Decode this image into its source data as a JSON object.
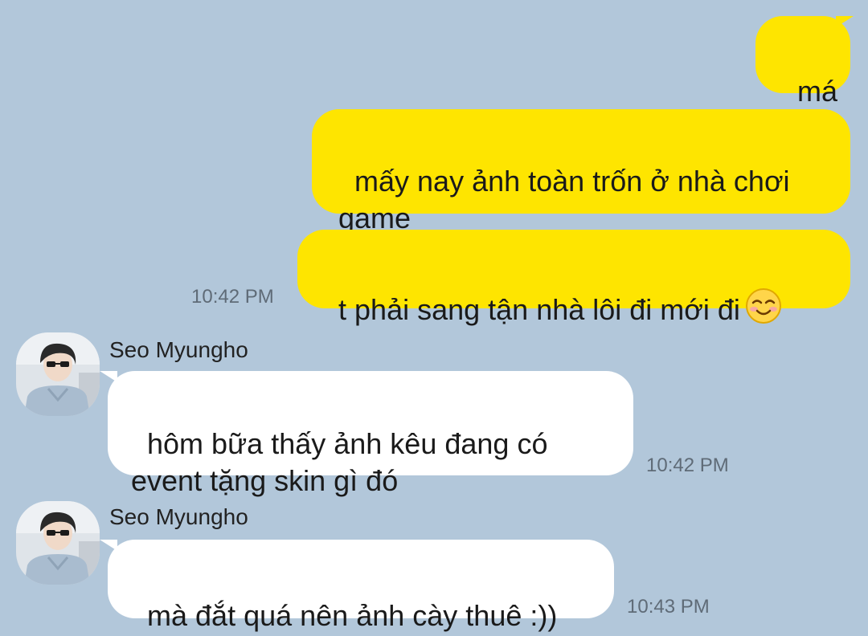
{
  "messages": [
    {
      "direction": "out",
      "text": "má"
    },
    {
      "direction": "out",
      "text": "mấy nay ảnh toàn trốn ở nhà chơi\ngame"
    },
    {
      "direction": "out",
      "text": "t phải sang tận nhà lôi đi mới đi",
      "emoji": "smiling-face-icon",
      "time": "10:42 PM"
    },
    {
      "direction": "in",
      "sender": "Seo Myungho",
      "text": "hôm bữa thấy ảnh kêu đang có\nevent tặng skin gì đó",
      "time": "10:42 PM"
    },
    {
      "direction": "in",
      "sender": "Seo Myungho",
      "text": "mà đắt quá nên ảnh cày thuê :))",
      "time": "10:43 PM"
    }
  ],
  "colors": {
    "background": "#b2c7da",
    "outgoing_bubble": "#fee500",
    "incoming_bubble": "#ffffff",
    "timestamp": "#5f6b77"
  }
}
